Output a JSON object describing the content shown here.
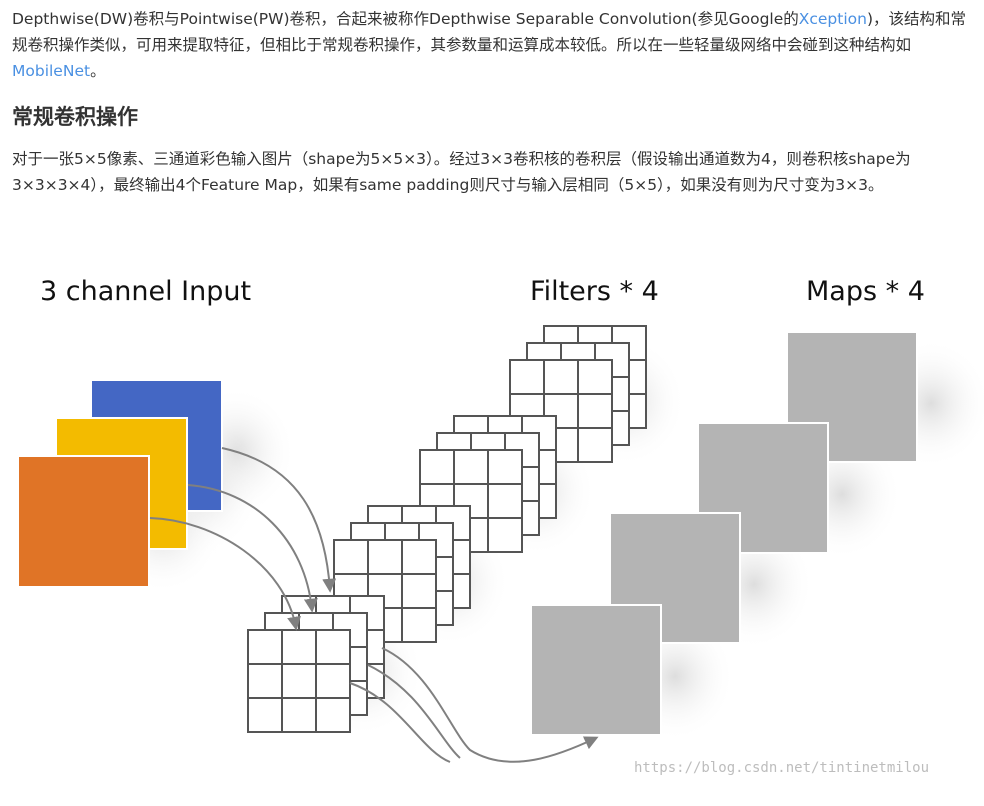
{
  "intro": {
    "text_before_link1": "Depthwise(DW)卷积与Pointwise(PW)卷积，合起来被称作Depthwise Separable Convolution(参见Google的",
    "link1": "Xception",
    "text_between_links": ")，该结构和常规卷积操作类似，可用来提取特征，但相比于常规卷积操作，其参数量和运算成本较低。所以在一些轻量级网络中会碰到这种结构如",
    "link2": "MobileNet",
    "text_after_link2": "。"
  },
  "section": {
    "heading": "常规卷积操作",
    "paragraph": "对于一张5×5像素、三通道彩色输入图片（shape为5×5×3）。经过3×3卷积核的卷积层（假设输出通道数为4，则卷积核shape为3×3×3×4），最终输出4个Feature Map，如果有same padding则尺寸与输入层相同（5×5），如果没有则为尺寸变为3×3。"
  },
  "diagram": {
    "input_label": "3 channel Input",
    "filters_label": "Filters * 4",
    "maps_label": "Maps * 4",
    "watermark": "https://blog.csdn.net/tintinetmilou",
    "channel_colors": [
      "#4467c4",
      "#f3bb00",
      "#e07426"
    ],
    "map_color": "#b4b4b4"
  }
}
